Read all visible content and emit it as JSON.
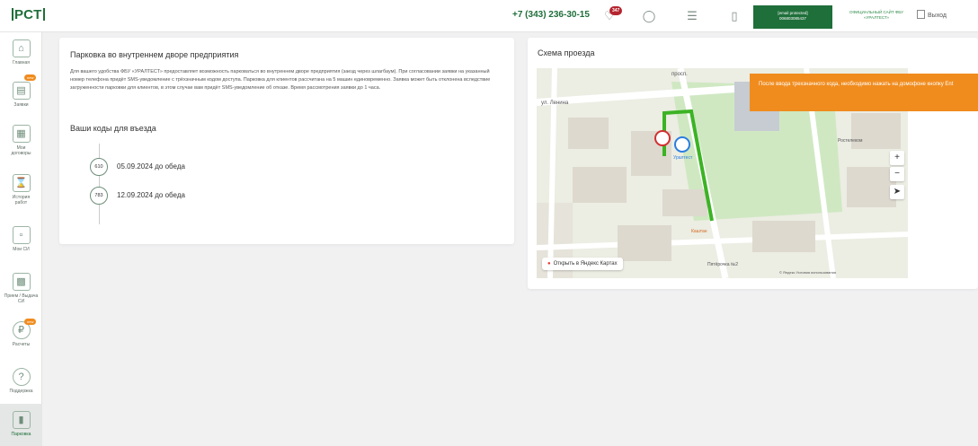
{
  "topbar": {
    "logo": "РСТ",
    "phone": "+7 (343) 236-30-15",
    "notifications_count": "347",
    "account_line1": "[email protected]",
    "account_line2": "006803085437",
    "official_site": "ОФИЦИАЛЬНЫЙ САЙТ ФБУ «УРАЛТЕСТ»",
    "logout": "Выход"
  },
  "sidebar": {
    "items": [
      {
        "label": "Главная",
        "icon": "home-icon"
      },
      {
        "label": "Заявки",
        "icon": "requests-icon",
        "badge": "new"
      },
      {
        "label": "Мои договоры",
        "icon": "contracts-icon"
      },
      {
        "label": "История работ",
        "icon": "hourglass-icon"
      },
      {
        "label": "Мои СИ",
        "icon": "instruments-icon"
      },
      {
        "label": "Прием / Выдача СИ",
        "icon": "delivery-icon"
      },
      {
        "label": "Расчеты",
        "icon": "ruble-icon",
        "badge": "new"
      },
      {
        "label": "Поддержка",
        "icon": "question-icon"
      },
      {
        "label": "Парковка",
        "icon": "parking-icon"
      }
    ]
  },
  "parking": {
    "title": "Парковка во внутреннем дворе предприятия",
    "description": "Для вашего удобства ФБУ «УРАЛТЕСТ» предоставляет возможность парковаться во внутреннем дворе предприятия (заезд через шлагбаум). При согласовании заявки на указанный номер телефона придёт SMS-уведомление с трёхзначным кодом доступа. Парковка для клиентов рассчитана на 5 машин единовременно. Заявка может быть отклонена вследствие загруженности парковки для клиентов, в этом случае вам придёт SMS-уведомление об отказе. Время рассмотрения заявки до 1 часа.",
    "codes_title": "Ваши коды для въезда",
    "codes": [
      {
        "code": "610",
        "text": "05.09.2024 до обеда"
      },
      {
        "code": "783",
        "text": "12.09.2024 до обеда"
      }
    ]
  },
  "route": {
    "title": "Схема проезда",
    "note": "После ввода трехзначного кода, необходимо нажать на домофоне кнопку Ent",
    "open_link": "Открыть в Яндекс Картах",
    "map_footer": "© Яндекс  Условия использования",
    "map_labels": [
      "ул. Ленина",
      "просп.",
      "Уралтест",
      "Каштан",
      "Ростелеком",
      "Пятёрочка №2"
    ]
  },
  "colors": {
    "brand": "#1f6f3a",
    "accent": "#f08c1e",
    "badge": "#b5252f",
    "route": "#3cb324"
  }
}
